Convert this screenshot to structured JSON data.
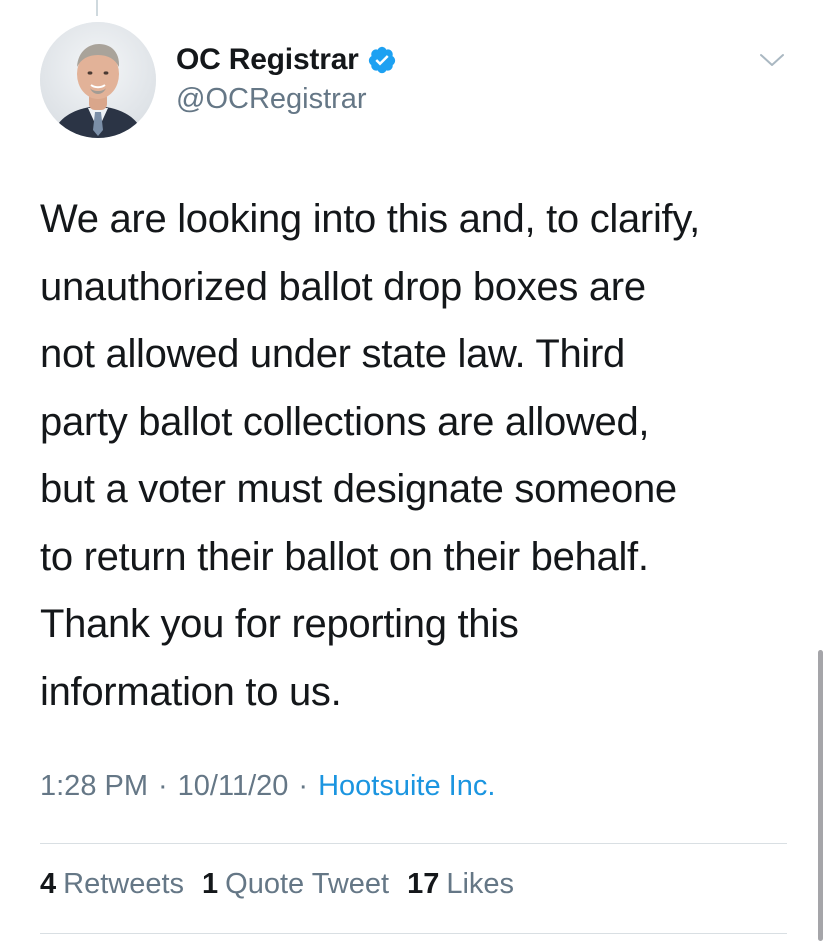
{
  "tweet": {
    "display_name": "OC Registrar",
    "handle": "@OCRegistrar",
    "verified": true,
    "text": "We are looking into this and, to clarify,\nunauthorized ballot drop boxes are\nnot allowed under state law. Third\nparty ballot collections are allowed,\nbut a voter must designate someone\nto return their ballot on their behalf.\nThank you for reporting this\ninformation to us.",
    "time": "1:28 PM",
    "date": "10/11/20",
    "separator": "·",
    "source": "Hootsuite Inc."
  },
  "stats": {
    "retweets_count": "4",
    "retweets_label": "Retweets",
    "quotes_count": "1",
    "quotes_label": "Quote Tweet",
    "likes_count": "17",
    "likes_label": "Likes"
  },
  "icons": {
    "avatar": "profile-photo",
    "verified": "verified-badge-icon",
    "menu": "chevron-down-icon"
  },
  "colors": {
    "text": "#14171a",
    "secondary": "#657786",
    "link": "#1b95e0",
    "verified": "#1da1f2"
  }
}
